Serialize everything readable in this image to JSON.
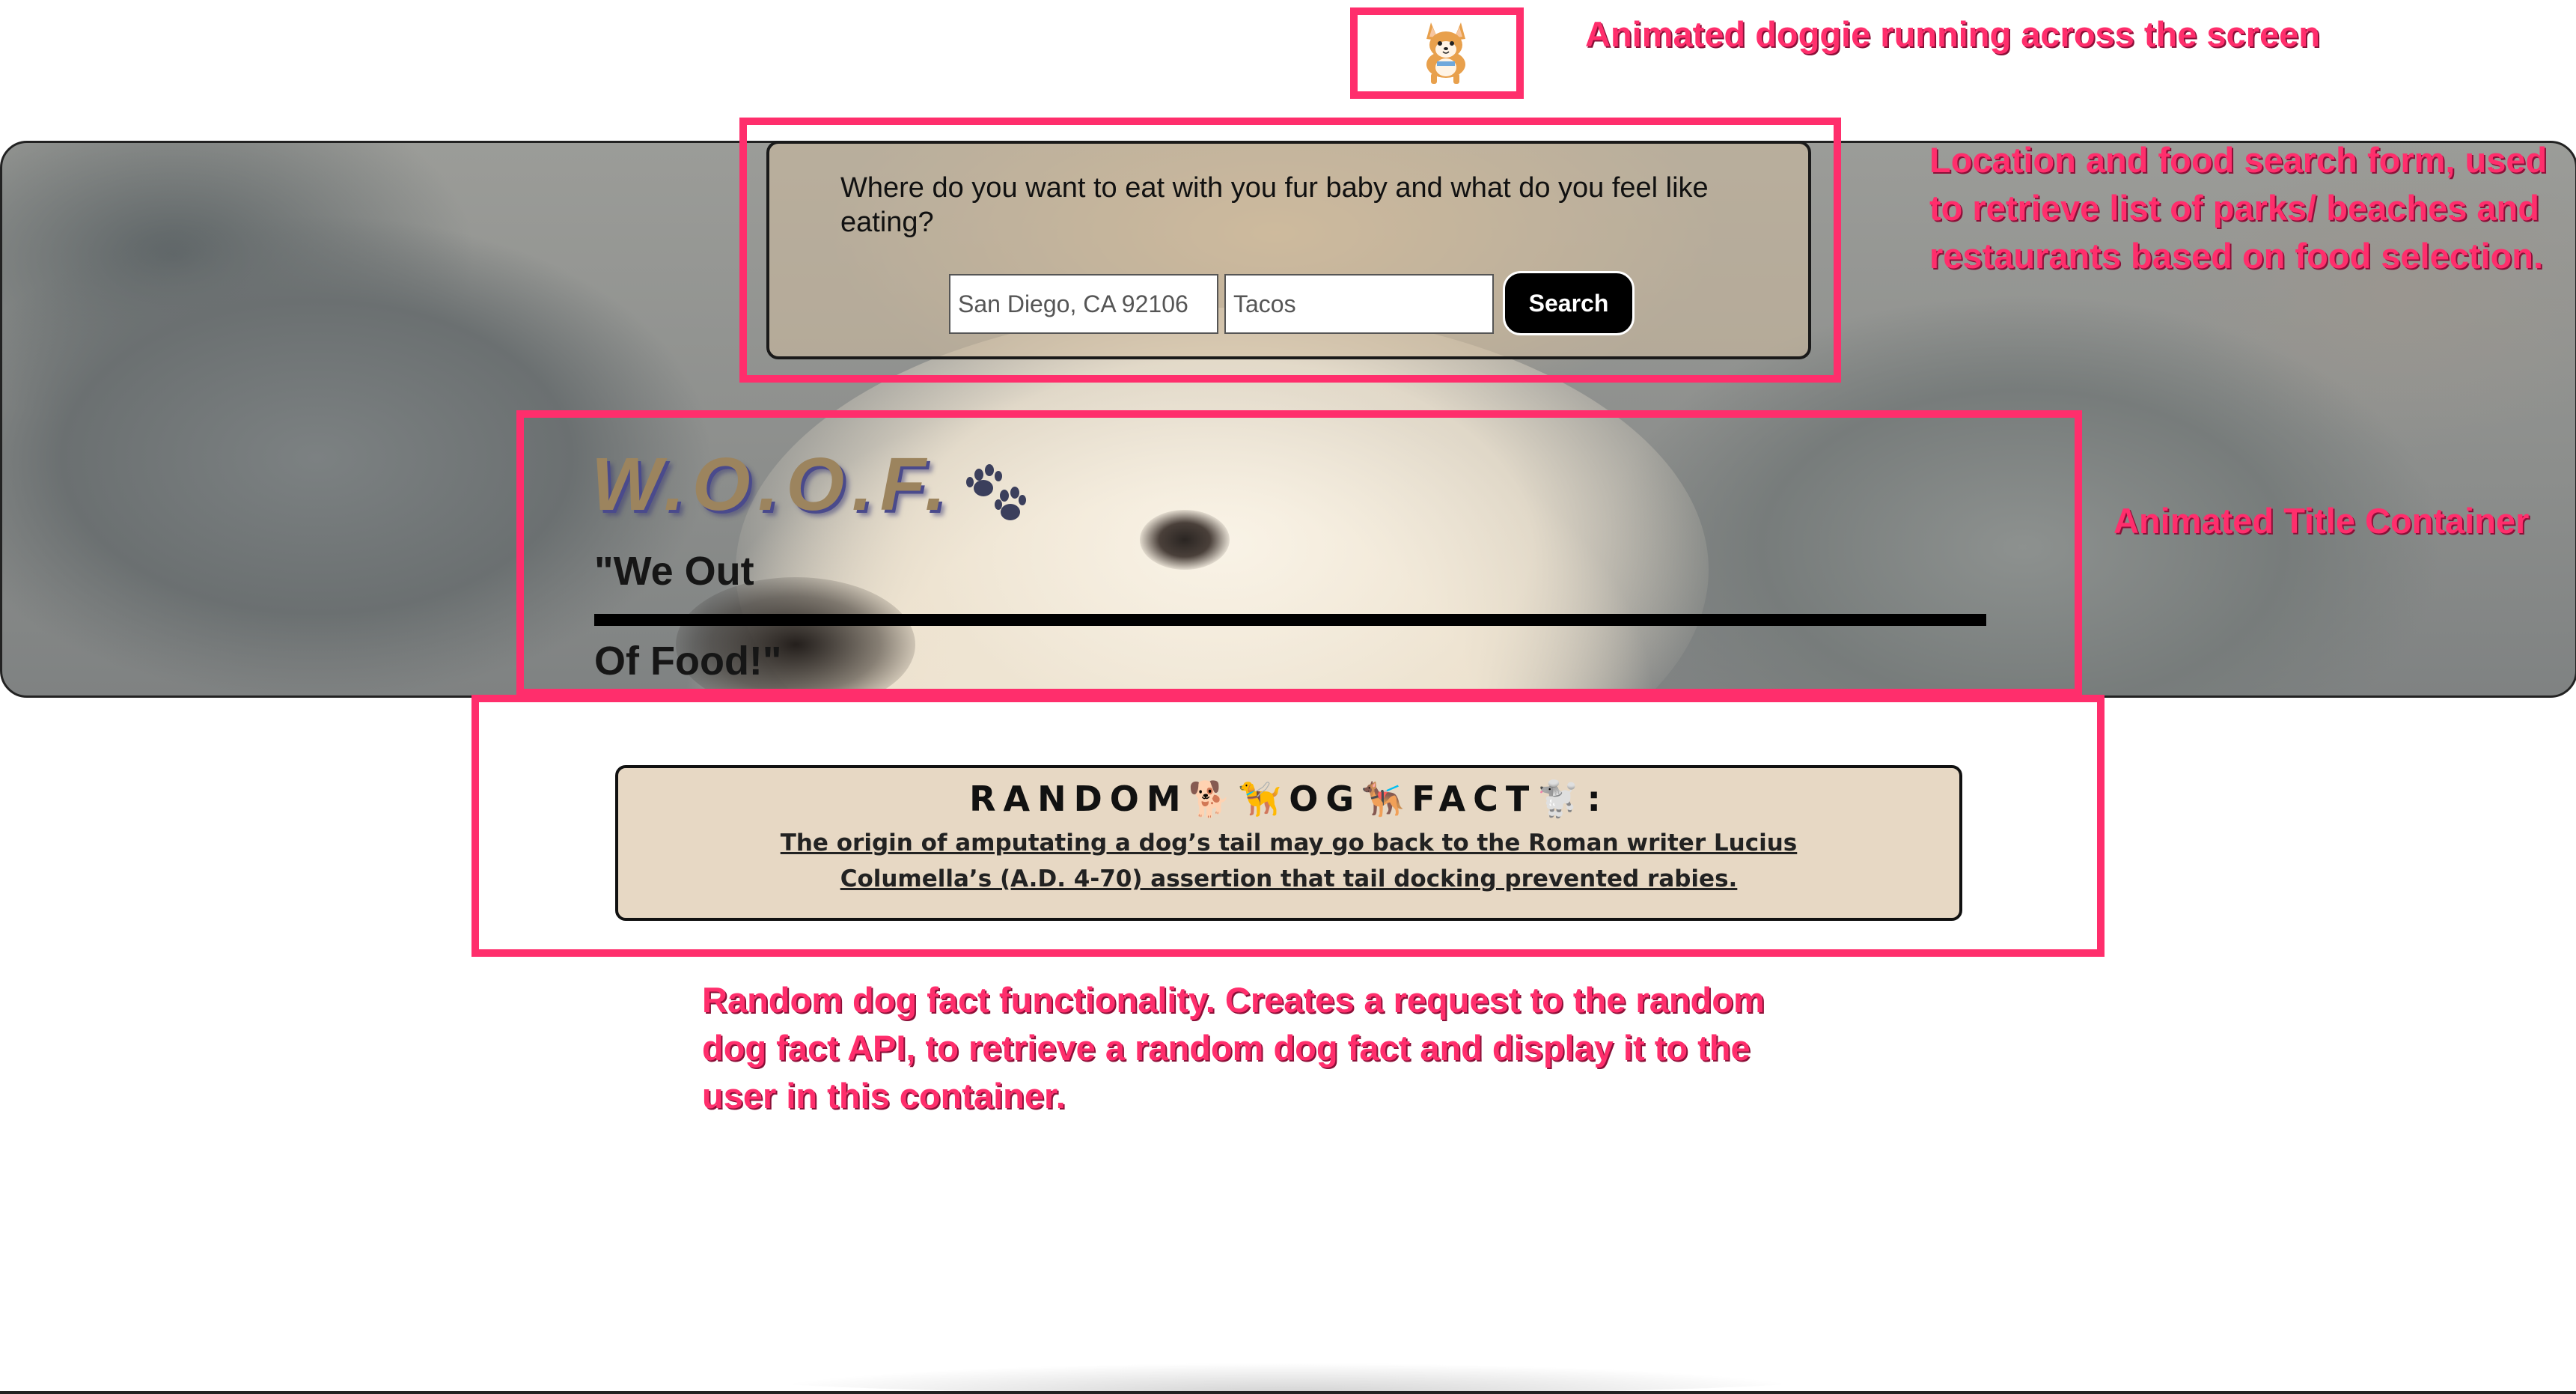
{
  "corgi": {
    "icon": "corgi-icon"
  },
  "search": {
    "question": "Where do you want to eat with you fur baby and what do you feel like eating?",
    "location_value": "San Diego, CA 92106",
    "food_value": "Tacos",
    "button_label": "Search"
  },
  "title": {
    "woof": "W.O.O.F.",
    "paw_icon": "paw-prints-icon",
    "tagline_line1": "\"We Out",
    "tagline_line2": "Of Food!\""
  },
  "fact": {
    "heading": "RANDOM🐕🦮OG🐕‍🦺FACT🐩:",
    "text": "The origin of amputating a dog’s tail may go back to the Roman writer Lucius Columella’s (A.D. 4-70) assertion that tail docking prevented rabies."
  },
  "annotations": {
    "dog": "Animated doggie running across the screen",
    "search": "Location and food search form, used to retrieve list of parks/ beaches and restaurants based on food selection.",
    "title": "Animated Title Container",
    "fact": "Random dog fact functionality. Creates a request to the random dog fact API, to retrieve a random dog fact and display it to the user in this container."
  },
  "colors": {
    "annotation": "#ff2e6c",
    "fact_background": "#e7d8c4",
    "woof_gold": "#9c845e",
    "woof_shadow": "#4a4a8c"
  }
}
